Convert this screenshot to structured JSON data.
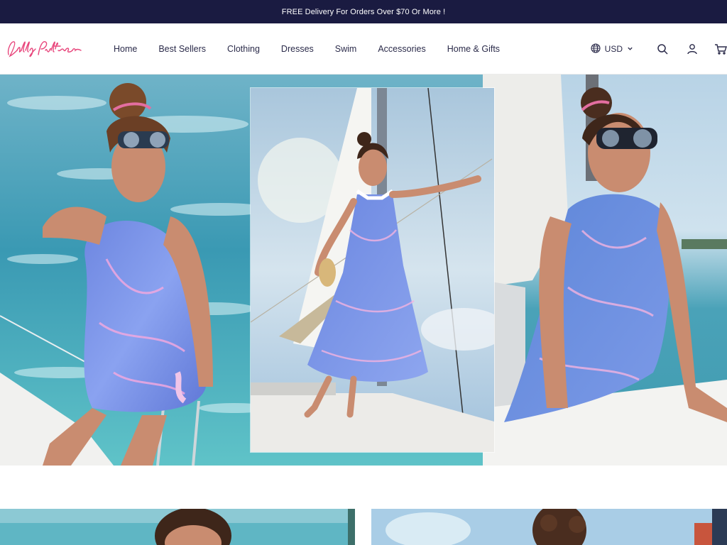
{
  "announcement": {
    "text": "FREE Delivery For Orders Over $70 Or More !"
  },
  "brand": {
    "logo_alt": "Lilly Pulitzer",
    "accent": "#e8467c",
    "navy": "#1a1b41"
  },
  "nav": {
    "items": [
      {
        "label": "Home"
      },
      {
        "label": "Best Sellers"
      },
      {
        "label": "Clothing"
      },
      {
        "label": "Dresses"
      },
      {
        "label": "Swim"
      },
      {
        "label": "Accessories"
      },
      {
        "label": "Home & Gifts"
      }
    ]
  },
  "utility": {
    "currency": "USD",
    "icons": [
      "globe-icon",
      "chevron-down-icon",
      "search-icon",
      "account-icon",
      "cart-icon"
    ]
  },
  "hero": {
    "panels": [
      "model-in-short-dress-on-boat",
      "model-in-maxi-dress-on-bow",
      "model-seated-on-deck"
    ]
  }
}
